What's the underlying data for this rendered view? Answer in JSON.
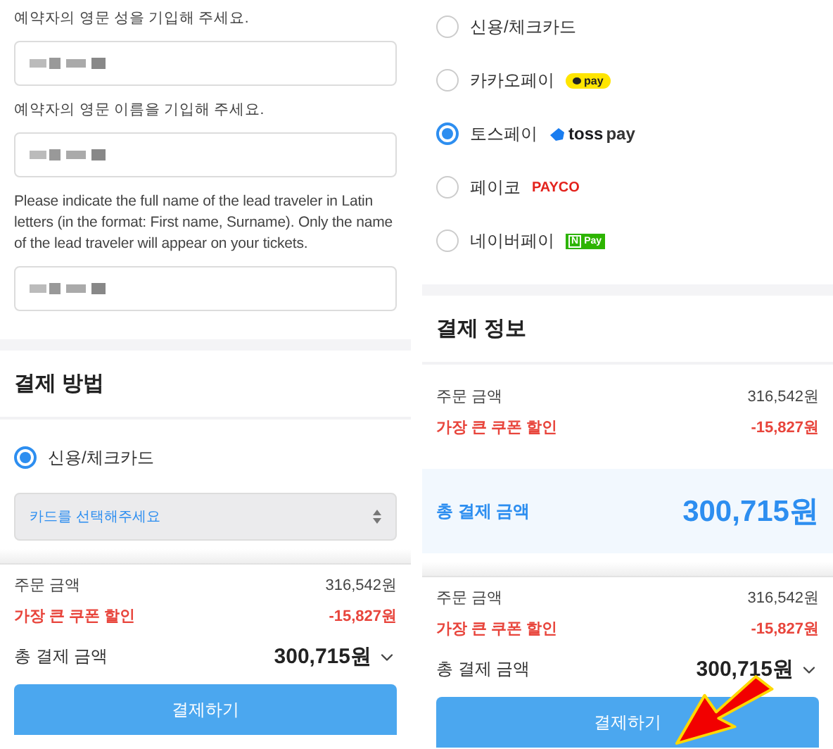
{
  "left": {
    "fields": [
      {
        "label": "예약자의 영문 성을 기입해 주세요.",
        "redacted": true
      },
      {
        "label": "예약자의 영문 이름을 기입해 주세요.",
        "redacted": true
      },
      {
        "label": "Please indicate the full name of the lead traveler in Latin letters (in the format: First name, Surname). Only the name of the lead traveler will appear on your tickets.",
        "redacted": true
      }
    ],
    "payment": {
      "title": "결제 방법",
      "options": [
        {
          "label": "신용/체크카드",
          "selected": true
        }
      ],
      "card_select": {
        "placeholder": "카드를 선택해주세요"
      }
    },
    "summary": {
      "rows": [
        {
          "label": "주문 금액",
          "amount": "316,542원",
          "kind": "normal"
        },
        {
          "label": "가장 큰 쿠폰 할인",
          "amount": "-15,827원",
          "kind": "discount"
        }
      ],
      "total_label": "총 결제 금액",
      "total_amount": "300,715원",
      "button": "결제하기"
    }
  },
  "right": {
    "options": [
      {
        "label": "신용/체크카드",
        "selected": false
      },
      {
        "label": "카카오페이",
        "selected": false,
        "logo": "pay",
        "kind": "kakao"
      },
      {
        "label": "토스페이",
        "selected": true,
        "logo": "toss",
        "logo_2": "pay",
        "kind": "toss"
      },
      {
        "label": "페이코",
        "selected": false,
        "logo": "PAYCO",
        "kind": "payco"
      },
      {
        "label": "네이버페이",
        "selected": false,
        "logo": "N",
        "logo_2": "Pay",
        "kind": "naver"
      }
    ],
    "info": {
      "title": "결제 정보",
      "rows": [
        {
          "label": "주문 금액",
          "amount": "316,542원",
          "kind": "normal"
        },
        {
          "label": "가장 큰 쿠폰 할인",
          "amount": "-15,827원",
          "kind": "discount"
        }
      ],
      "total_label": "총 결제 금액",
      "total_amount": "300,715원"
    },
    "summary": {
      "rows": [
        {
          "label": "주문 금액",
          "amount": "316,542원",
          "kind": "normal"
        },
        {
          "label": "가장 큰 쿠폰 할인",
          "amount": "-15,827원",
          "kind": "discount"
        }
      ],
      "total_label": "총 결제 금액",
      "total_amount": "300,715원",
      "button": "결제하기"
    }
  }
}
